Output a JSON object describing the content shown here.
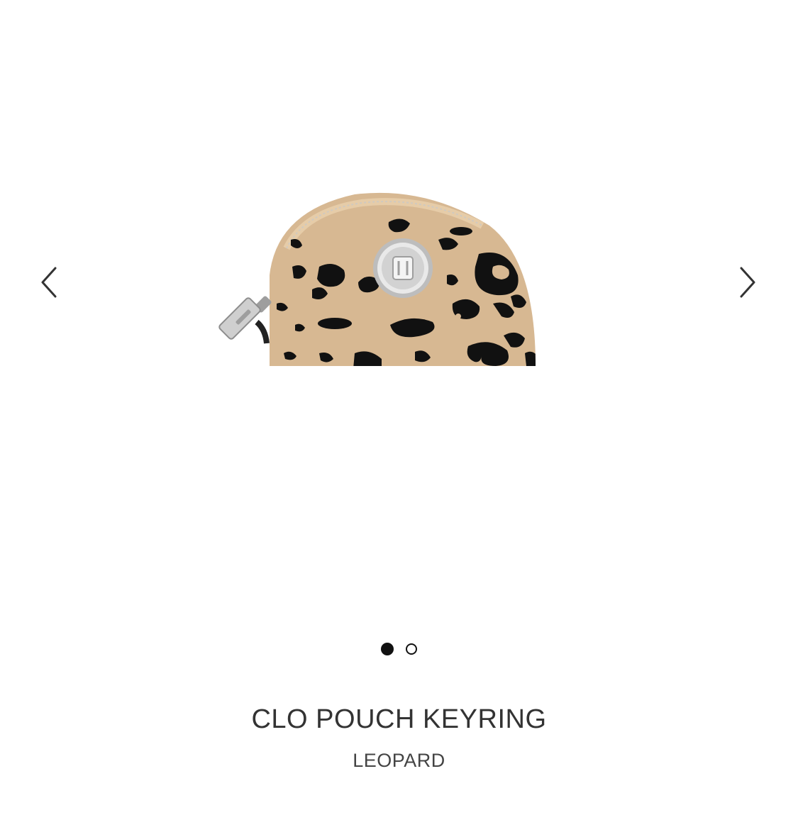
{
  "product": {
    "name": "CLO POUCH KEYRING",
    "variant": "LEOPARD",
    "image_alt": "CLO POUCH KEYRING"
  },
  "carousel": {
    "slide_count": 2,
    "active_index": 0,
    "prev_icon": "chevron-left-icon",
    "next_icon": "chevron-right-icon"
  },
  "colors": {
    "pouch_base": "#D7B892",
    "pouch_spots": "#111111",
    "hardware": "#C9C9C9"
  }
}
